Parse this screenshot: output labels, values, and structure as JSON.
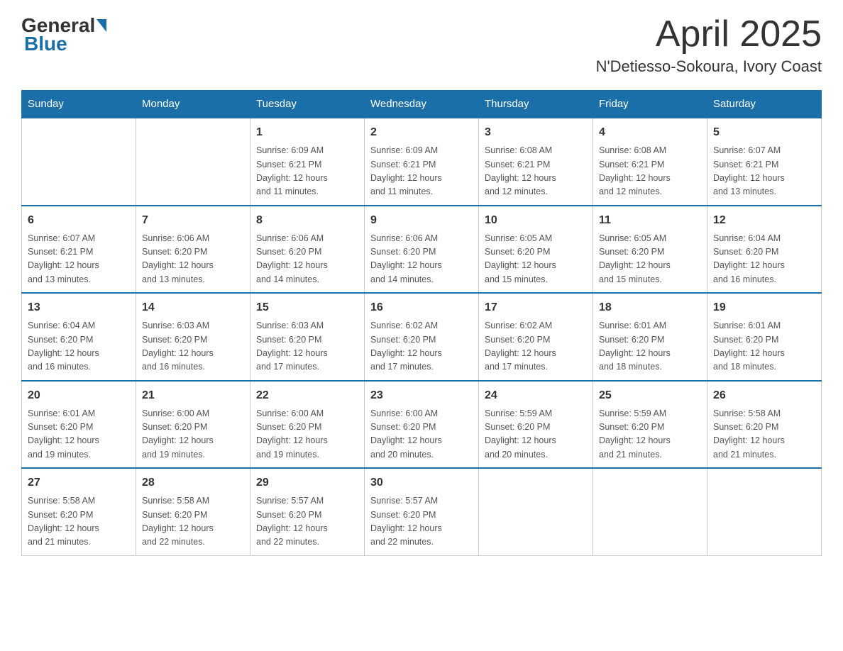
{
  "logo": {
    "general": "General",
    "blue": "Blue"
  },
  "title": "April 2025",
  "location": "N'Detiesso-Sokoura, Ivory Coast",
  "headers": [
    "Sunday",
    "Monday",
    "Tuesday",
    "Wednesday",
    "Thursday",
    "Friday",
    "Saturday"
  ],
  "weeks": [
    [
      {
        "day": "",
        "info": ""
      },
      {
        "day": "",
        "info": ""
      },
      {
        "day": "1",
        "info": "Sunrise: 6:09 AM\nSunset: 6:21 PM\nDaylight: 12 hours\nand 11 minutes."
      },
      {
        "day": "2",
        "info": "Sunrise: 6:09 AM\nSunset: 6:21 PM\nDaylight: 12 hours\nand 11 minutes."
      },
      {
        "day": "3",
        "info": "Sunrise: 6:08 AM\nSunset: 6:21 PM\nDaylight: 12 hours\nand 12 minutes."
      },
      {
        "day": "4",
        "info": "Sunrise: 6:08 AM\nSunset: 6:21 PM\nDaylight: 12 hours\nand 12 minutes."
      },
      {
        "day": "5",
        "info": "Sunrise: 6:07 AM\nSunset: 6:21 PM\nDaylight: 12 hours\nand 13 minutes."
      }
    ],
    [
      {
        "day": "6",
        "info": "Sunrise: 6:07 AM\nSunset: 6:21 PM\nDaylight: 12 hours\nand 13 minutes."
      },
      {
        "day": "7",
        "info": "Sunrise: 6:06 AM\nSunset: 6:20 PM\nDaylight: 12 hours\nand 13 minutes."
      },
      {
        "day": "8",
        "info": "Sunrise: 6:06 AM\nSunset: 6:20 PM\nDaylight: 12 hours\nand 14 minutes."
      },
      {
        "day": "9",
        "info": "Sunrise: 6:06 AM\nSunset: 6:20 PM\nDaylight: 12 hours\nand 14 minutes."
      },
      {
        "day": "10",
        "info": "Sunrise: 6:05 AM\nSunset: 6:20 PM\nDaylight: 12 hours\nand 15 minutes."
      },
      {
        "day": "11",
        "info": "Sunrise: 6:05 AM\nSunset: 6:20 PM\nDaylight: 12 hours\nand 15 minutes."
      },
      {
        "day": "12",
        "info": "Sunrise: 6:04 AM\nSunset: 6:20 PM\nDaylight: 12 hours\nand 16 minutes."
      }
    ],
    [
      {
        "day": "13",
        "info": "Sunrise: 6:04 AM\nSunset: 6:20 PM\nDaylight: 12 hours\nand 16 minutes."
      },
      {
        "day": "14",
        "info": "Sunrise: 6:03 AM\nSunset: 6:20 PM\nDaylight: 12 hours\nand 16 minutes."
      },
      {
        "day": "15",
        "info": "Sunrise: 6:03 AM\nSunset: 6:20 PM\nDaylight: 12 hours\nand 17 minutes."
      },
      {
        "day": "16",
        "info": "Sunrise: 6:02 AM\nSunset: 6:20 PM\nDaylight: 12 hours\nand 17 minutes."
      },
      {
        "day": "17",
        "info": "Sunrise: 6:02 AM\nSunset: 6:20 PM\nDaylight: 12 hours\nand 17 minutes."
      },
      {
        "day": "18",
        "info": "Sunrise: 6:01 AM\nSunset: 6:20 PM\nDaylight: 12 hours\nand 18 minutes."
      },
      {
        "day": "19",
        "info": "Sunrise: 6:01 AM\nSunset: 6:20 PM\nDaylight: 12 hours\nand 18 minutes."
      }
    ],
    [
      {
        "day": "20",
        "info": "Sunrise: 6:01 AM\nSunset: 6:20 PM\nDaylight: 12 hours\nand 19 minutes."
      },
      {
        "day": "21",
        "info": "Sunrise: 6:00 AM\nSunset: 6:20 PM\nDaylight: 12 hours\nand 19 minutes."
      },
      {
        "day": "22",
        "info": "Sunrise: 6:00 AM\nSunset: 6:20 PM\nDaylight: 12 hours\nand 19 minutes."
      },
      {
        "day": "23",
        "info": "Sunrise: 6:00 AM\nSunset: 6:20 PM\nDaylight: 12 hours\nand 20 minutes."
      },
      {
        "day": "24",
        "info": "Sunrise: 5:59 AM\nSunset: 6:20 PM\nDaylight: 12 hours\nand 20 minutes."
      },
      {
        "day": "25",
        "info": "Sunrise: 5:59 AM\nSunset: 6:20 PM\nDaylight: 12 hours\nand 21 minutes."
      },
      {
        "day": "26",
        "info": "Sunrise: 5:58 AM\nSunset: 6:20 PM\nDaylight: 12 hours\nand 21 minutes."
      }
    ],
    [
      {
        "day": "27",
        "info": "Sunrise: 5:58 AM\nSunset: 6:20 PM\nDaylight: 12 hours\nand 21 minutes."
      },
      {
        "day": "28",
        "info": "Sunrise: 5:58 AM\nSunset: 6:20 PM\nDaylight: 12 hours\nand 22 minutes."
      },
      {
        "day": "29",
        "info": "Sunrise: 5:57 AM\nSunset: 6:20 PM\nDaylight: 12 hours\nand 22 minutes."
      },
      {
        "day": "30",
        "info": "Sunrise: 5:57 AM\nSunset: 6:20 PM\nDaylight: 12 hours\nand 22 minutes."
      },
      {
        "day": "",
        "info": ""
      },
      {
        "day": "",
        "info": ""
      },
      {
        "day": "",
        "info": ""
      }
    ]
  ]
}
